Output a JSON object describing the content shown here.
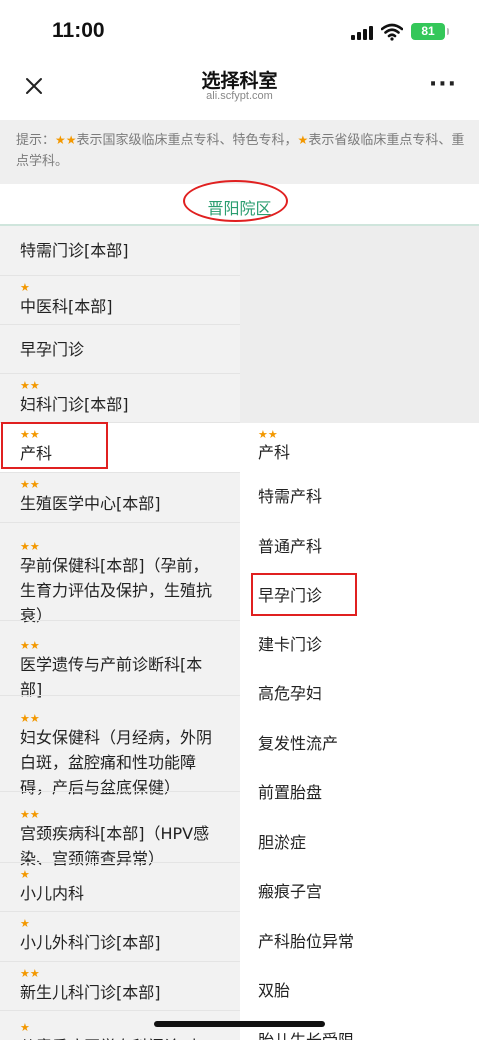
{
  "status_bar": {
    "time": "11:00",
    "battery": "81"
  },
  "nav": {
    "title": "选择科室",
    "subtitle": "ali.scfypt.com"
  },
  "tip": {
    "prefix": "提示：",
    "national_stars": "★★",
    "national_text": "表示国家级临床重点专科、特色专科，",
    "provincial_star": "★",
    "provincial_text": "表示省级临床重点专科、重点学科。"
  },
  "tab": {
    "label": "晋阳院区"
  },
  "departments": [
    {
      "stars": "",
      "name": "特需门诊[本部]"
    },
    {
      "stars": "★",
      "name": "中医科[本部]"
    },
    {
      "stars": "",
      "name": "早孕门诊"
    },
    {
      "stars": "★★",
      "name": "妇科门诊[本部]"
    },
    {
      "stars": "★★",
      "name": "产科"
    },
    {
      "stars": "★★",
      "name": "生殖医学中心[本部]"
    },
    {
      "stars": "★★",
      "name": "孕前保健科[本部]（孕前，生育力评估及保护，生殖抗衰）"
    },
    {
      "stars": "★★",
      "name": "医学遗传与产前诊断科[本部]"
    },
    {
      "stars": "★★",
      "name": "妇女保健科（月经病，外阴白斑，盆腔痛和性功能障碍，产后与盆底保健）"
    },
    {
      "stars": "★★",
      "name": "宫颈疾病科[本部]（HPV感染、宫颈筛查异常）"
    },
    {
      "stars": "★",
      "name": "小儿内科"
    },
    {
      "stars": "★",
      "name": "小儿外科门诊[本部]"
    },
    {
      "stars": "★★",
      "name": "新生儿科门诊[本部]"
    },
    {
      "stars": "★",
      "name": "儿童重症医学专科门诊[本"
    }
  ],
  "sub_departments": [
    {
      "stars": "★★",
      "name": "产科"
    },
    {
      "stars": "",
      "name": "特需产科"
    },
    {
      "stars": "",
      "name": "普通产科"
    },
    {
      "stars": "",
      "name": "早孕门诊"
    },
    {
      "stars": "",
      "name": "建卡门诊"
    },
    {
      "stars": "",
      "name": "高危孕妇"
    },
    {
      "stars": "",
      "name": "复发性流产"
    },
    {
      "stars": "",
      "name": "前置胎盘"
    },
    {
      "stars": "",
      "name": "胆淤症"
    },
    {
      "stars": "",
      "name": "瘢痕子宫"
    },
    {
      "stars": "",
      "name": "产科胎位异常"
    },
    {
      "stars": "",
      "name": "双胎"
    },
    {
      "stars": "",
      "name": "胎儿生长受限"
    }
  ],
  "colors": {
    "accent": "#2a9d6f",
    "star": "#f39800",
    "highlight": "#e02020"
  }
}
